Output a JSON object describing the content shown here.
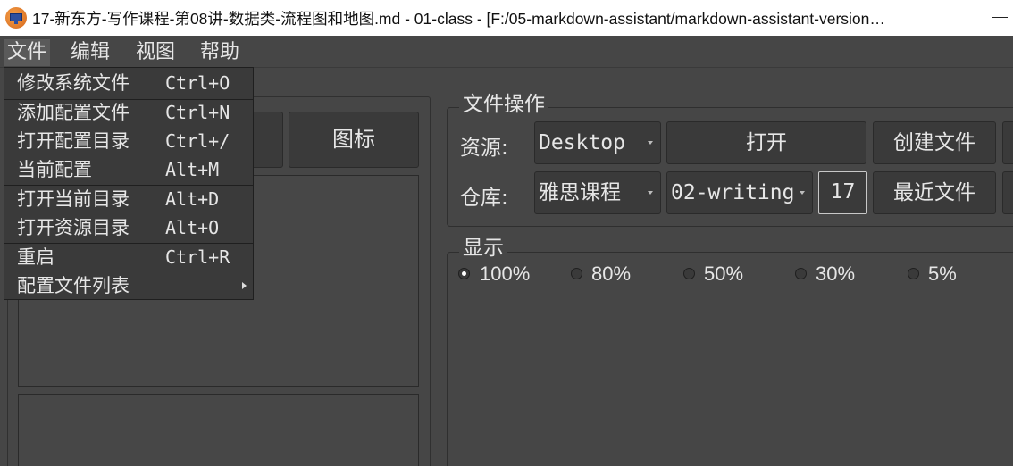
{
  "window": {
    "title": "17-新东方-写作课程-第08讲-数据类-流程图和地图.md - 01-class - [F:/05-markdown-assistant/markdown-assistant-version…"
  },
  "menubar": {
    "items": [
      {
        "label": "文件"
      },
      {
        "label": "编辑"
      },
      {
        "label": "视图"
      },
      {
        "label": "帮助"
      }
    ]
  },
  "file_menu": {
    "items": [
      {
        "label": "修改系统文件",
        "shortcut": "Ctrl+O"
      },
      {
        "label": "添加配置文件",
        "shortcut": "Ctrl+N"
      },
      {
        "label": "打开配置目录",
        "shortcut": "Ctrl+/"
      },
      {
        "label": "当前配置",
        "shortcut": "Alt+M"
      },
      {
        "label": "打开当前目录",
        "shortcut": "Alt+D"
      },
      {
        "label": "打开资源目录",
        "shortcut": "Alt+O"
      },
      {
        "label": "重启",
        "shortcut": "Ctrl+R"
      },
      {
        "label": "配置文件列表",
        "shortcut": ""
      }
    ]
  },
  "left_panel": {
    "icon_button_label": "图标"
  },
  "file_ops": {
    "title": "文件操作",
    "source_label": "资源:",
    "source_value": "Desktop",
    "open_button": "打开",
    "create_button": "创建文件",
    "repo_label": "仓库:",
    "repo_value": "雅思课程",
    "branch_value": "02-writing",
    "count_value": "17",
    "recent_button": "最近文件"
  },
  "display": {
    "title": "显示",
    "options": [
      {
        "label": "100%",
        "checked": true
      },
      {
        "label": "80%",
        "checked": false
      },
      {
        "label": "50%",
        "checked": false
      },
      {
        "label": "30%",
        "checked": false
      },
      {
        "label": "5%",
        "checked": false
      }
    ]
  }
}
